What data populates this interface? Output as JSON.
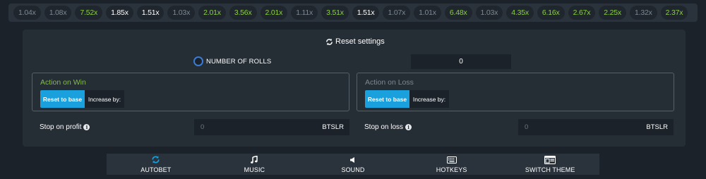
{
  "history": [
    {
      "value": "1.04x",
      "tone": "low"
    },
    {
      "value": "1.08x",
      "tone": "low"
    },
    {
      "value": "7.52x",
      "tone": "high"
    },
    {
      "value": "1.85x",
      "tone": "mid"
    },
    {
      "value": "1.51x",
      "tone": "mid"
    },
    {
      "value": "1.03x",
      "tone": "low"
    },
    {
      "value": "2.01x",
      "tone": "high"
    },
    {
      "value": "3.56x",
      "tone": "high"
    },
    {
      "value": "2.01x",
      "tone": "high"
    },
    {
      "value": "1.11x",
      "tone": "low"
    },
    {
      "value": "3.51x",
      "tone": "high"
    },
    {
      "value": "1.51x",
      "tone": "mid"
    },
    {
      "value": "1.07x",
      "tone": "low"
    },
    {
      "value": "1.01x",
      "tone": "low"
    },
    {
      "value": "6.48x",
      "tone": "high"
    },
    {
      "value": "1.03x",
      "tone": "low"
    },
    {
      "value": "4.35x",
      "tone": "high"
    },
    {
      "value": "6.16x",
      "tone": "high"
    },
    {
      "value": "2.67x",
      "tone": "high"
    },
    {
      "value": "2.25x",
      "tone": "high"
    },
    {
      "value": "1.32x",
      "tone": "low"
    },
    {
      "value": "2.37x",
      "tone": "high"
    }
  ],
  "settings": {
    "reset_label": "Reset settings",
    "rolls_label": "NUMBER OF ROLLS",
    "rolls_value": "0",
    "win": {
      "title": "Action on Win",
      "reset_label": "Reset to base",
      "increase_label": "Increase by:"
    },
    "loss": {
      "title": "Action on Loss",
      "reset_label": "Reset to base",
      "increase_label": "Increase by:"
    },
    "stop_profit": {
      "label": "Stop on profit",
      "value": "0",
      "currency": "BTSLR"
    },
    "stop_loss": {
      "label": "Stop on loss",
      "value": "0",
      "currency": "BTSLR"
    }
  },
  "nav": {
    "autobet": "AUTOBET",
    "music": "MUSIC",
    "sound": "SOUND",
    "hotkeys": "HOTKEYS",
    "switch_theme": "SWITCH THEME"
  },
  "colors": {
    "accent": "#1aa0dd",
    "win": "#7fc23a",
    "high_multiplier": "#8bd042",
    "low_multiplier": "#7d8893"
  },
  "icons": {
    "reset": "refresh-icon",
    "info": "info-icon",
    "autobet": "autobet-icon",
    "music": "music-note-icon",
    "sound": "speaker-icon",
    "hotkeys": "keyboard-icon",
    "switch_theme": "theme-icon"
  }
}
